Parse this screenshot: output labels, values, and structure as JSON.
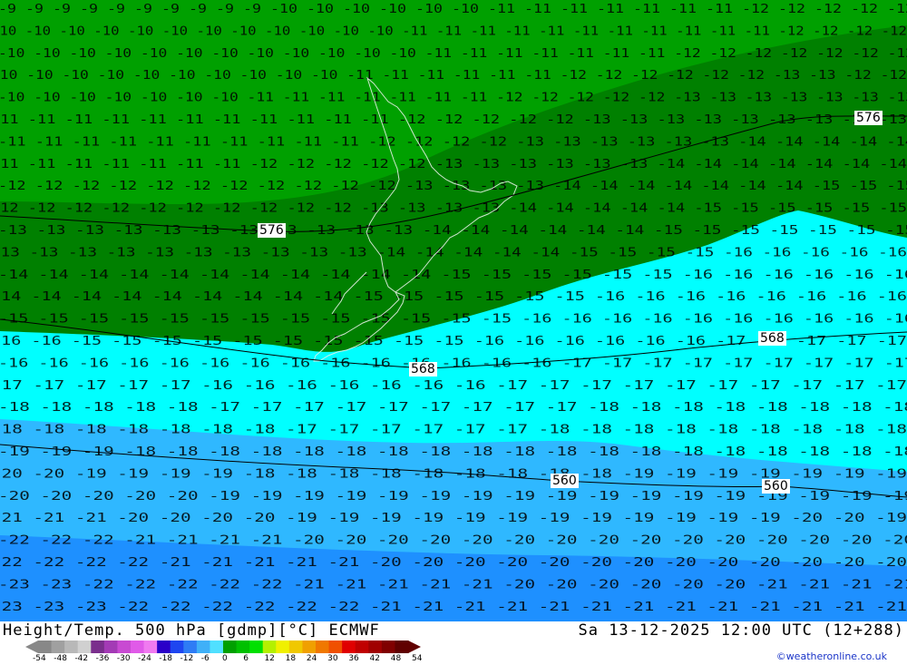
{
  "title": "Height/Temp. 500 hPa [gdmp][°C] ECMWF",
  "datetime": "Sa 13-12-2025 12:00 UTC (12+288)",
  "credit": "©weatheronline.co.uk",
  "isolines": [
    {
      "value": "576"
    },
    {
      "value": "576"
    },
    {
      "value": "568"
    },
    {
      "value": "568"
    },
    {
      "value": "560"
    },
    {
      "value": "560"
    }
  ],
  "legend": {
    "ticks": [
      "-54",
      "-48",
      "-42",
      "-36",
      "-30",
      "-24",
      "-18",
      "-12",
      "-6",
      "0",
      "6",
      "12",
      "18",
      "24",
      "30",
      "36",
      "42",
      "48",
      "54"
    ],
    "colors": [
      "#888888",
      "#a0a0a0",
      "#b8b8b8",
      "#d0d0d0",
      "#7a2e8c",
      "#a33ab5",
      "#c84ad2",
      "#e05ae8",
      "#f07af0",
      "#2a00c8",
      "#1e46f0",
      "#2e7cf5",
      "#3fb0f8",
      "#50e0ff",
      "#00a000",
      "#00c000",
      "#00e000",
      "#b4f000",
      "#f0f000",
      "#f0c800",
      "#f0a000",
      "#f07800",
      "#f05000",
      "#e00000",
      "#c00000",
      "#a00000",
      "#800000",
      "#600000"
    ]
  },
  "colors": {
    "band_dark_green": "#008000",
    "band_green": "#00a000",
    "band_cyan": "#00ffff",
    "band_light_blue": "#2fb8ff",
    "band_blue": "#1e90ff",
    "contour": "#000000",
    "coast": "#ffffff"
  },
  "temperature_rows": [
    "-9 -9 -9 -9 -9 -9 -9 -9 -9 -9 -10 -10 -10 -10 -10 -10 -11 -11 -11 -11 -11 -11 -11 -12 -12 -12 -12 -12",
    "-10 -10 -10 -10 -10 -10 -10 -10 -10 -10 -10 -10 -11 -11 -11 -11 -11 -11 -11 -11 -11 -11 -11 -12 -12 -12 -12",
    "-10 -10 -10 -10 -10 -10 -10 -10 -10 -10 -10 -10 -11 -11 -11 -11 -11 -11 -11 -12 -12 -12 -12 -12 -12 -12",
    "-10 -10 -10 -10 -10 -10 -10 -10 -10 -10 -11 -11 -11 -11 -11 -11 -12 -12 -12 -12 -12 -12 -13 -13 -12 -12",
    "-10 -10 -10 -10 -10 -10 -10 -11 -11 -11 -11 -11 -11 -11 -12 -12 -12 -12 -12 -13 -13 -13 -13 -13 -13 -13",
    "-11 -11 -11 -11 -11 -11 -11 -11 -11 -11 -11 -12 -12 -12 -12 -12 -13 -13 -13 -13 -13 -13 -13 -13 -13",
    "-11 -11 -11 -11 -11 -11 -11 -11 -11 -11 -12 -12 -12 -12 -13 -13 -13 -13 -13 -13 -14 -14 -14 -14 -14",
    "-11 -11 -11 -11 -11 -11 -11 -12 -12 -12 -12 -12 -13 -13 -13 -13 -13 -13 -14 -14 -14 -14 -14 -14 -14",
    "-12 -12 -12 -12 -12 -12 -12 -12 -12 -12 -12 -13 -13 -13 -13 -14 -14 -14 -14 -14 -14 -14 -15 -15 -15",
    "-12 -12 -12 -12 -12 -12 -12 -12 -12 -12 -13 -13 -13 -13 -14 -14 -14 -14 -14 -15 -15 -15 -15 -15 -15",
    "-13 -13 -13 -13 -13 -13 -13 -13 -13 -13 -13 -14 -14 -14 -14 -14 -14 -15 -15 -15 -15 -15 -15 -15",
    "-13 -13 -13 -13 -13 -13 -13 -13 -13 -13 -14 -14 -14 -14 -14 -15 -15 -15 -15 -16 -16 -16 -16 -16",
    "-14 -14 -14 -14 -14 -14 -14 -14 -14 -14 -14 -15 -15 -15 -15 -15 -15 -16 -16 -16 -16 -16 -16",
    "-14 -14 -14 -14 -14 -14 -14 -14 -14 -15 -15 -15 -15 -15 -15 -16 -16 -16 -16 -16 -16 -16 -16",
    "-15 -15 -15 -15 -15 -15 -15 -15 -15 -15 -15 -15 -15 -16 -16 -16 -16 -16 -16 -16 -16 -16 -16",
    "-16 -16 -15 -15 -15 -15 -15 -15 -15 -15 -15 -15 -16 -16 -16 -16 -16 -16 -17 -17 -17 -17 -17",
    "-16 -16 -16 -16 -16 -16 -16 -16 -16 -16 -16 -16 -16 -16 -17 -17 -17 -17 -17 -17 -17 -17 -17",
    "-17 -17 -17 -17 -17 -16 -16 -16 -16 -16 -16 -16 -17 -17 -17 -17 -17 -17 -17 -17 -17 -17",
    "-18 -18 -18 -18 -18 -17 -17 -17 -17 -17 -17 -17 -17 -17 -18 -18 -18 -18 -18 -18 -18 -18",
    "-18 -18 -18 -18 -18 -18 -18 -17 -17 -17 -17 -17 -17 -18 -18 -18 -18 -18 -18 -18 -18 -18",
    "-19 -19 -19 -18 -18 -18 -18 -18 -18 -18 -18 -18 -18 -18 -18 -18 -18 -18 -18 -18 -18 -18",
    "-20 -20 -19 -19 -19 -19 -18 -18 -18 -18 -18 -18 -18 -18 -18 -19 -19 -19 -19 -19 -19 -19",
    "-20 -20 -20 -20 -20 -19 -19 -19 -19 -19 -19 -19 -19 -19 -19 -19 -19 -19 -19 -19 -19 -19",
    "-21 -21 -21 -20 -20 -20 -20 -19 -19 -19 -19 -19 -19 -19 -19 -19 -19 -19 -19 -20 -20 -19",
    "-22 -22 -22 -21 -21 -21 -21 -20 -20 -20 -20 -20 -20 -20 -20 -20 -20 -20 -20 -20 -20 -20",
    "-22 -22 -22 -22 -21 -21 -21 -21 -21 -20 -20 -20 -20 -20 -20 -20 -20 -20 -20 -20 -20 -20",
    "-23 -23 -22 -22 -22 -22 -22 -21 -21 -21 -21 -21 -20 -20 -20 -20 -20 -20 -21 -21 -21 -21",
    "-23 -23 -23 -22 -22 -22 -22 -22 -22 -21 -21 -21 -21 -21 -21 -21 -21 -21 -21 -21 -21 -21"
  ]
}
